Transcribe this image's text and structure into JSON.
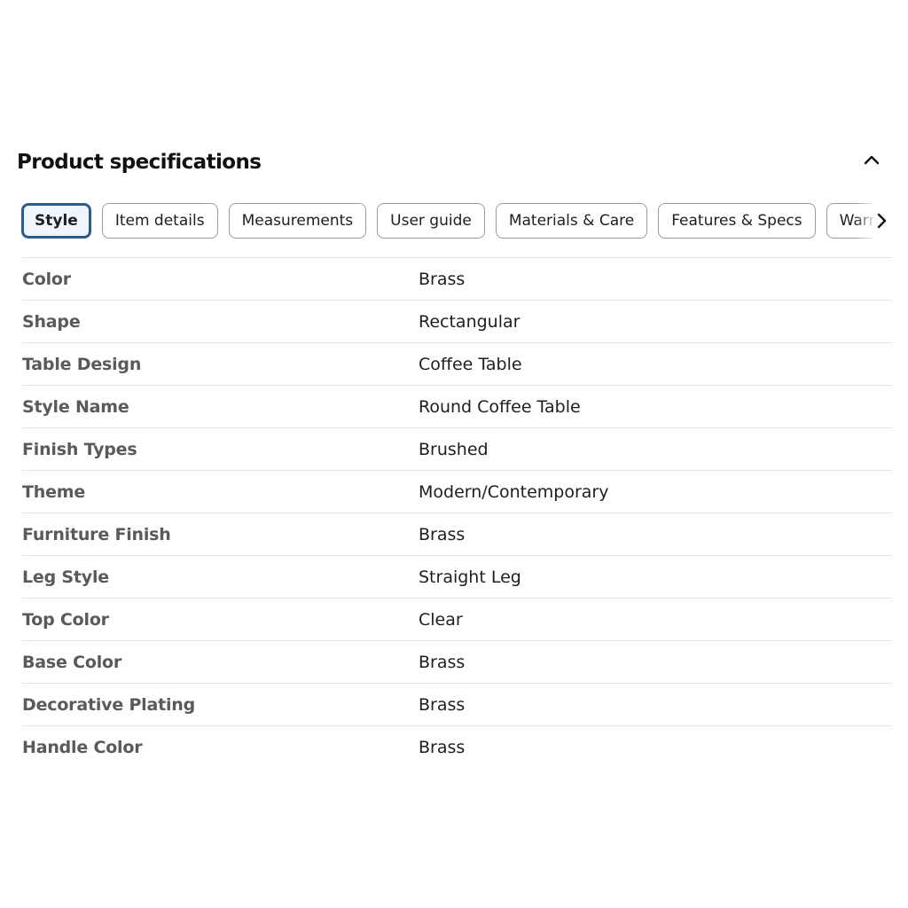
{
  "section": {
    "title": "Product specifications",
    "collapse_icon": "chevron-up-icon"
  },
  "tabs": {
    "items": [
      {
        "label": "Style",
        "active": true
      },
      {
        "label": "Item details",
        "active": false
      },
      {
        "label": "Measurements",
        "active": false
      },
      {
        "label": "User guide",
        "active": false
      },
      {
        "label": "Materials & Care",
        "active": false
      },
      {
        "label": "Features & Specs",
        "active": false
      },
      {
        "label": "Warranty",
        "active": false
      }
    ],
    "next_icon": "chevron-right-icon"
  },
  "specs": [
    {
      "label": "Color",
      "value": "Brass"
    },
    {
      "label": "Shape",
      "value": "Rectangular"
    },
    {
      "label": "Table Design",
      "value": "Coffee Table"
    },
    {
      "label": "Style Name",
      "value": "Round Coffee Table"
    },
    {
      "label": "Finish Types",
      "value": "Brushed"
    },
    {
      "label": "Theme",
      "value": "Modern/Contemporary"
    },
    {
      "label": "Furniture Finish",
      "value": "Brass"
    },
    {
      "label": "Leg Style",
      "value": "Straight Leg"
    },
    {
      "label": "Top Color",
      "value": "Clear"
    },
    {
      "label": "Base Color",
      "value": "Brass"
    },
    {
      "label": "Decorative Plating",
      "value": "Brass"
    },
    {
      "label": "Handle Color",
      "value": "Brass"
    }
  ],
  "colors": {
    "active_tab_border": "#2b5c8f",
    "active_tab_bg": "#eef5fc",
    "label_text": "#5a5a5a",
    "value_text": "#1e1e1e",
    "divider": "#e3e3e3"
  }
}
